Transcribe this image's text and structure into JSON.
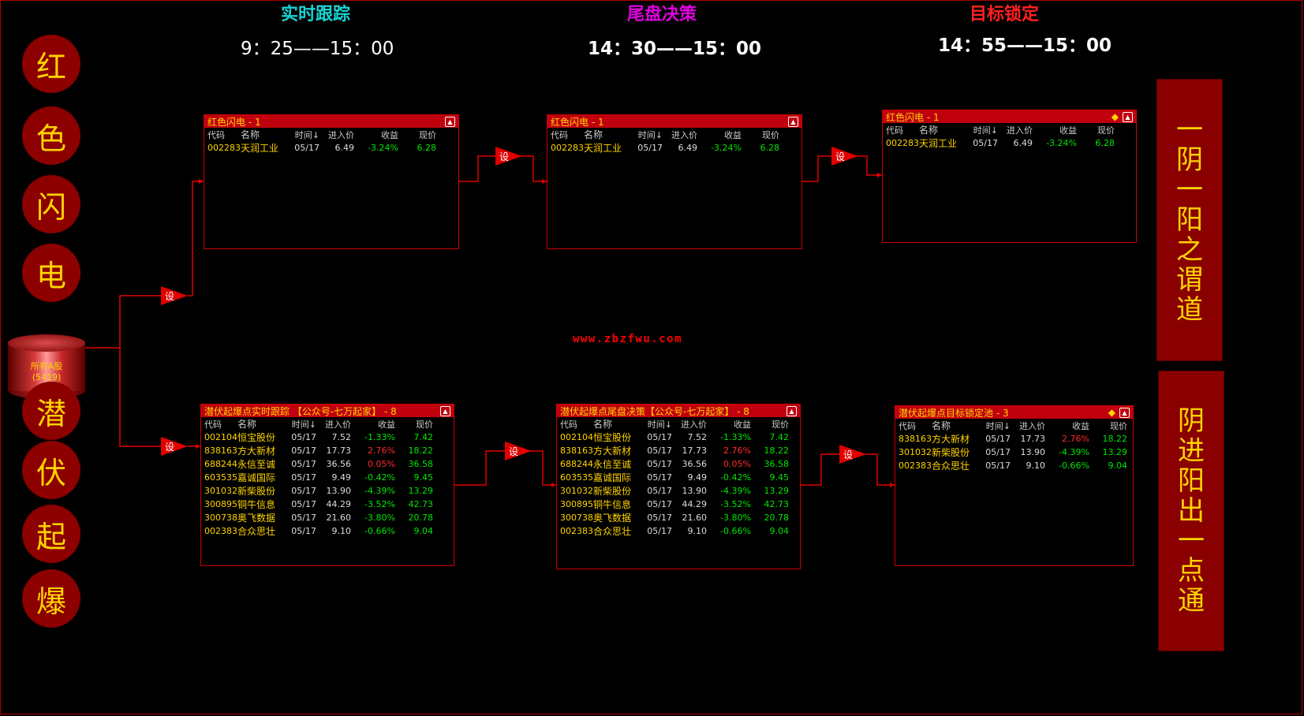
{
  "stages": [
    {
      "title": "实时跟踪",
      "time": "9：25——15：00",
      "color": "#18d4d4"
    },
    {
      "title": "尾盘决策",
      "time": "14：30——15：00",
      "color": "#e000e0"
    },
    {
      "title": "目标锁定",
      "time": "14：55——15：00",
      "color": "#ff2020"
    }
  ],
  "left_top_chars": [
    "红",
    "色",
    "闪",
    "电"
  ],
  "left_bottom_chars": [
    "潜",
    "伏",
    "起",
    "爆"
  ],
  "source": {
    "label": "所有A股",
    "count": "(5419)"
  },
  "set_label": "设",
  "watermark": "www.zbzfwu.com",
  "side_right_top": [
    "一",
    "阴",
    "一",
    "阳",
    "之",
    "谓",
    "道"
  ],
  "side_right_bottom": [
    "阴",
    "进",
    "阳",
    "出",
    "一",
    "点",
    "通"
  ],
  "columns": [
    "代码",
    "名称",
    "时间↓",
    "进入价",
    "收益",
    "现价"
  ],
  "panels": {
    "top1": {
      "title": "红色闪电 - 1",
      "rows": [
        [
          "002283",
          "天润工业",
          "05/17",
          "6.49",
          "-3.24%",
          "6.28"
        ]
      ]
    },
    "top2": {
      "title": "红色闪电 - 1",
      "rows": [
        [
          "002283",
          "天润工业",
          "05/17",
          "6.49",
          "-3.24%",
          "6.28"
        ]
      ]
    },
    "top3": {
      "title": "红色闪电 - 1",
      "rows": [
        [
          "002283",
          "天润工业",
          "05/17",
          "6.49",
          "-3.24%",
          "6.28"
        ]
      ]
    },
    "bot1": {
      "title": "潜伏起爆点实时跟踪 【公众号-七万起家】 - 8",
      "rows": [
        [
          "002104",
          "恒宝股份",
          "05/17",
          "7.52",
          "-1.33%",
          "7.42"
        ],
        [
          "838163",
          "方大新材",
          "05/17",
          "17.73",
          "2.76%",
          "18.22"
        ],
        [
          "688244",
          "永信至诚",
          "05/17",
          "36.56",
          "0.05%",
          "36.58"
        ],
        [
          "603535",
          "嘉诚国际",
          "05/17",
          "9.49",
          "-0.42%",
          "9.45"
        ],
        [
          "301032",
          "新柴股份",
          "05/17",
          "13.90",
          "-4.39%",
          "13.29"
        ],
        [
          "300895",
          "铜牛信息",
          "05/17",
          "44.29",
          "-3.52%",
          "42.73"
        ],
        [
          "300738",
          "奥飞数据",
          "05/17",
          "21.60",
          "-3.80%",
          "20.78"
        ],
        [
          "002383",
          "合众思壮",
          "05/17",
          "9.10",
          "-0.66%",
          "9.04"
        ]
      ]
    },
    "bot2": {
      "title": "潜伏起爆点尾盘决策【公众号-七万起家】 - 8",
      "rows": [
        [
          "002104",
          "恒宝股份",
          "05/17",
          "7.52",
          "-1.33%",
          "7.42"
        ],
        [
          "838163",
          "方大新材",
          "05/17",
          "17.73",
          "2.76%",
          "18.22"
        ],
        [
          "688244",
          "永信至诚",
          "05/17",
          "36.56",
          "0.05%",
          "36.58"
        ],
        [
          "603535",
          "嘉诚国际",
          "05/17",
          "9.49",
          "-0.42%",
          "9.45"
        ],
        [
          "301032",
          "新柴股份",
          "05/17",
          "13.90",
          "-4.39%",
          "13.29"
        ],
        [
          "300895",
          "铜牛信息",
          "05/17",
          "44.29",
          "-3.52%",
          "42.73"
        ],
        [
          "300738",
          "奥飞数据",
          "05/17",
          "21.60",
          "-3.80%",
          "20.78"
        ],
        [
          "002383",
          "合众思壮",
          "05/17",
          "9.10",
          "-0.66%",
          "9.04"
        ]
      ]
    },
    "bot3": {
      "title": "潜伏起爆点目标锁定池 - 3",
      "rows": [
        [
          "838163",
          "方大新材",
          "05/17",
          "17.73",
          "2.76%",
          "18.22"
        ],
        [
          "301032",
          "新柴股份",
          "05/17",
          "13.90",
          "-4.39%",
          "13.29"
        ],
        [
          "002383",
          "合众思壮",
          "05/17",
          "9.10",
          "-0.66%",
          "9.04"
        ]
      ]
    }
  }
}
